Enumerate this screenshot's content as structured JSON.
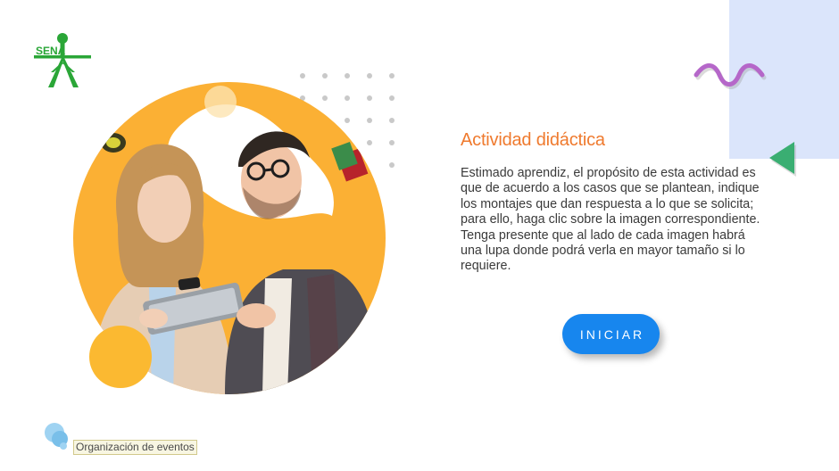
{
  "brand": {
    "logo_text": "SENA"
  },
  "activity": {
    "title": "Actividad didáctica",
    "description": "Estimado aprendiz, el propósito de esta actividad es que de acuerdo a los casos que se plantean, indique los montajes que dan respuesta a lo que se solicita; para ello, haga clic sobre la imagen correspondiente. Tenga presente que al lado de cada imagen habrá una lupa donde podrá verla en mayor tamaño si lo requiere.",
    "start_label": "INICIAR"
  },
  "footer": {
    "tooltip_text": "Organización de eventos"
  },
  "colors": {
    "accent_orange": "#ef7a2e",
    "button_blue": "#1786ee",
    "logo_green": "#2aa637",
    "panel_blue": "#dbe5fb",
    "squiggle_purple": "#b567c9",
    "triangle_green": "#3aae72",
    "hero_yellow": "#fbb034"
  },
  "icons": {
    "logo": "sena-logo-icon",
    "decor": [
      "dot-grid-decoration",
      "squiggle-decoration",
      "triangle-decoration"
    ],
    "tooltip": "speech-bubble-icon"
  }
}
